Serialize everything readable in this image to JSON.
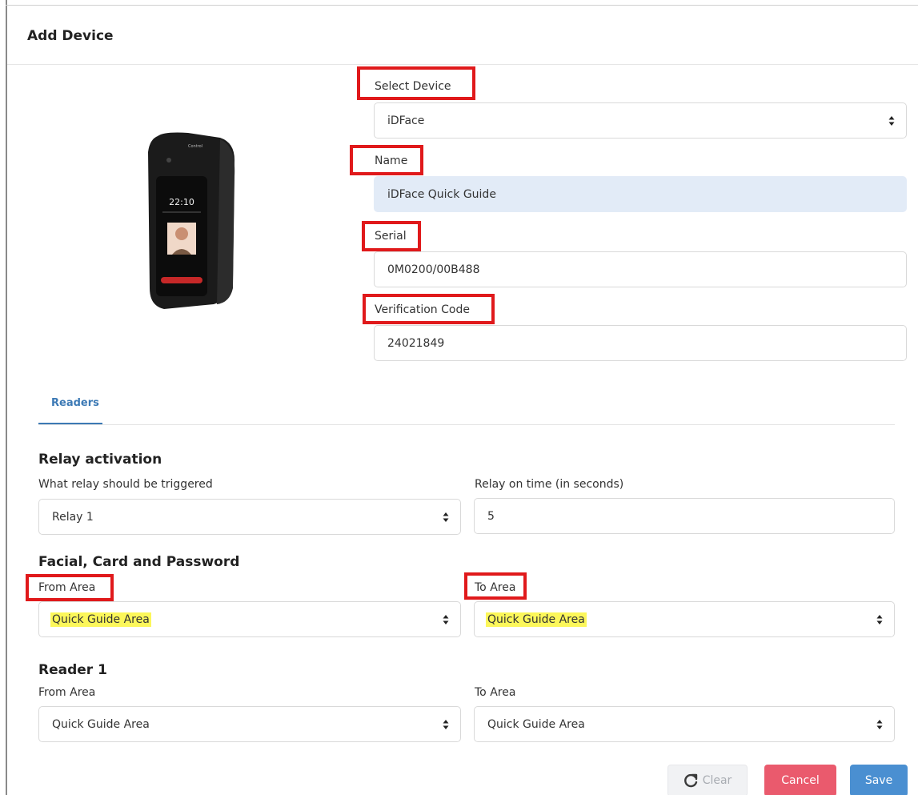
{
  "header": {
    "title": "Add Device"
  },
  "device": {
    "select_label": "Select Device",
    "select_value": "iDFace",
    "name_label": "Name",
    "name_value": "iDFace Quick Guide",
    "serial_label": "Serial",
    "serial_value": "0M0200/00B488",
    "verification_label": "Verification Code",
    "verification_value": "24021849",
    "screen_time": "22:10"
  },
  "tabs": [
    {
      "label": "Readers"
    }
  ],
  "relay": {
    "title": "Relay activation",
    "trigger_label": "What relay should be triggered",
    "trigger_value": "Relay 1",
    "time_label": "Relay on time (in seconds)",
    "time_value": "5"
  },
  "facial": {
    "title": "Facial, Card and Password",
    "from_label": "From Area",
    "from_value": "Quick Guide Area",
    "to_label": "To Area",
    "to_value": "Quick Guide Area"
  },
  "reader1": {
    "title": "Reader 1",
    "from_label": "From Area",
    "from_value": "Quick Guide Area",
    "to_label": "To Area",
    "to_value": "Quick Guide Area"
  },
  "buttons": {
    "clear": "Clear",
    "cancel": "Cancel",
    "save": "Save"
  },
  "colors": {
    "annotation_red": "#e0191b",
    "highlight_yellow": "#fcf75a",
    "accent_blue": "#3d7ab5",
    "cancel_red": "#ea5a6d",
    "save_blue": "#4a8fd1",
    "filled_field": "#e2ebf7"
  }
}
